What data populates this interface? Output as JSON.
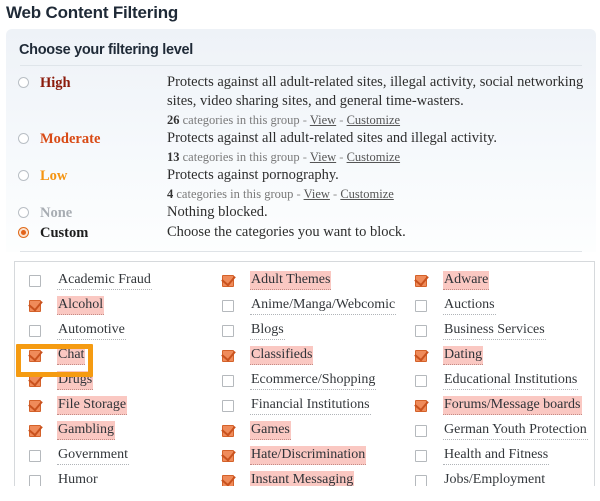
{
  "page": {
    "title": "Web Content Filtering"
  },
  "panel": {
    "heading": "Choose your filtering level"
  },
  "levels": [
    {
      "name": "High",
      "selected": false,
      "description": "Protects against all adult-related sites, illegal activity, social networking sites, video sharing sites, and general time-wasters.",
      "count": "26",
      "meta_text": "categories in this group",
      "view_label": "View",
      "customize_label": "Customize",
      "separator": "-",
      "color": "#8b1a0b"
    },
    {
      "name": "Moderate",
      "selected": false,
      "description": "Protects against all adult-related sites and illegal activity.",
      "count": "13",
      "meta_text": "categories in this group",
      "view_label": "View",
      "customize_label": "Customize",
      "separator": "-",
      "color": "#d94b16"
    },
    {
      "name": "Low",
      "selected": false,
      "description": "Protects against pornography.",
      "count": "4",
      "meta_text": "categories in this group",
      "view_label": "View",
      "customize_label": "Customize",
      "separator": "-",
      "color": "#f59410"
    },
    {
      "name": "None",
      "selected": false,
      "description": "Nothing blocked.",
      "count": "",
      "meta_text": "",
      "view_label": "",
      "customize_label": "",
      "separator": "",
      "color": "#a8adb3"
    },
    {
      "name": "Custom",
      "selected": true,
      "description": "Choose the categories you want to block.",
      "count": "",
      "meta_text": "",
      "view_label": "",
      "customize_label": "",
      "separator": "",
      "color": "#1d1d1d"
    }
  ],
  "categories": {
    "column1": [
      {
        "label": "Academic Fraud",
        "checked": false
      },
      {
        "label": "Alcohol",
        "checked": true
      },
      {
        "label": "Automotive",
        "checked": false
      },
      {
        "label": "Chat",
        "checked": true
      },
      {
        "label": "Drugs",
        "checked": true
      },
      {
        "label": "File Storage",
        "checked": true
      },
      {
        "label": "Gambling",
        "checked": true
      },
      {
        "label": "Government",
        "checked": false
      },
      {
        "label": "Humor",
        "checked": false
      }
    ],
    "column2": [
      {
        "label": "Adult Themes",
        "checked": true
      },
      {
        "label": "Anime/Manga/Webcomic",
        "checked": false
      },
      {
        "label": "Blogs",
        "checked": false
      },
      {
        "label": "Classifieds",
        "checked": true
      },
      {
        "label": "Ecommerce/Shopping",
        "checked": false
      },
      {
        "label": "Financial Institutions",
        "checked": false
      },
      {
        "label": "Games",
        "checked": true
      },
      {
        "label": "Hate/Discrimination",
        "checked": true
      },
      {
        "label": "Instant Messaging",
        "checked": true
      }
    ],
    "column3": [
      {
        "label": "Adware",
        "checked": true
      },
      {
        "label": "Auctions",
        "checked": false
      },
      {
        "label": "Business Services",
        "checked": false
      },
      {
        "label": "Dating",
        "checked": true
      },
      {
        "label": "Educational Institutions",
        "checked": false
      },
      {
        "label": "Forums/Message boards",
        "checked": true
      },
      {
        "label": "German Youth Protection",
        "checked": false
      },
      {
        "label": "Health and Fitness",
        "checked": false
      },
      {
        "label": "Jobs/Employment",
        "checked": false
      }
    ]
  },
  "annotation": {
    "target_label": "Chat",
    "highlight_color": "#f59b11"
  }
}
